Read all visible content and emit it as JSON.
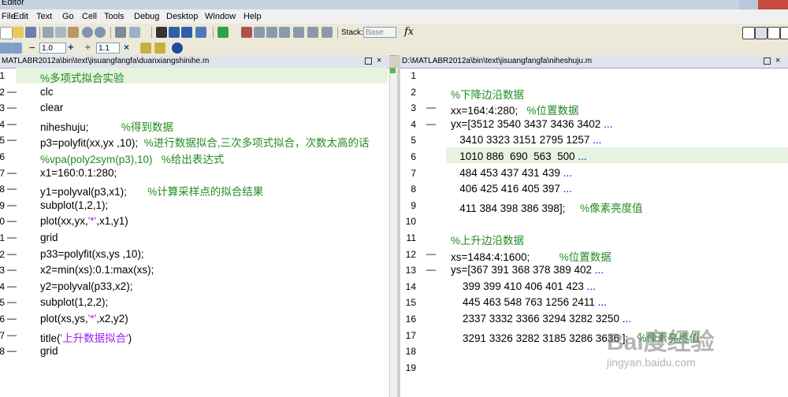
{
  "window": {
    "title": "Editor"
  },
  "menu": [
    "File",
    "Edit",
    "Text",
    "Go",
    "Cell",
    "Tools",
    "Debug",
    "Desktop",
    "Window",
    "Help"
  ],
  "toolbar": {
    "stack_label": "Stack:",
    "stack_value": "Base",
    "fx_label": "fx"
  },
  "cell_toolbar": {
    "minus": "−",
    "value1": "1.0",
    "plus": "+",
    "divide": "÷",
    "value2": "1.1",
    "times": "×"
  },
  "left_editor": {
    "path": "MATLABR2012a\\bin\\text\\jisuangfangfa\\duanxiangshinihe.m",
    "lines": [
      {
        "num": "1",
        "dash": "",
        "parts": [
          {
            "t": "%多项式拟合实验",
            "c": "cm"
          }
        ]
      },
      {
        "num": "2",
        "dash": "—",
        "parts": [
          {
            "t": "clc",
            "c": ""
          }
        ]
      },
      {
        "num": "3",
        "dash": "—",
        "parts": [
          {
            "t": "clear",
            "c": ""
          }
        ]
      },
      {
        "num": "4",
        "dash": "—",
        "parts": [
          {
            "t": "niheshuju;           ",
            "c": ""
          },
          {
            "t": "%得到数据",
            "c": "cm"
          }
        ]
      },
      {
        "num": "5",
        "dash": "—",
        "parts": [
          {
            "t": "p3=polyfit(xx,yx ,10);  ",
            "c": ""
          },
          {
            "t": "%进行数据拟合,三次多项式拟合，次数太高的话",
            "c": "cm"
          }
        ]
      },
      {
        "num": "6",
        "dash": "",
        "parts": [
          {
            "t": "%vpa(poly2sym(p3),10)   %给出表达式",
            "c": "cm"
          }
        ]
      },
      {
        "num": "7",
        "dash": "—",
        "parts": [
          {
            "t": "x1=160:0.1:280;",
            "c": ""
          }
        ]
      },
      {
        "num": "8",
        "dash": "—",
        "parts": [
          {
            "t": "y1=polyval(p3,x1);       ",
            "c": ""
          },
          {
            "t": "%计算采样点的拟合结果",
            "c": "cm"
          }
        ]
      },
      {
        "num": "9",
        "dash": "—",
        "parts": [
          {
            "t": "subplot(1,2,1);",
            "c": ""
          }
        ]
      },
      {
        "num": "10",
        "dash": "—",
        "parts": [
          {
            "t": "plot(xx,yx,",
            "c": ""
          },
          {
            "t": "'*'",
            "c": "str"
          },
          {
            "t": ",x1,y1)",
            "c": ""
          }
        ]
      },
      {
        "num": "11",
        "dash": "—",
        "parts": [
          {
            "t": "grid",
            "c": ""
          }
        ]
      },
      {
        "num": "12",
        "dash": "—",
        "parts": [
          {
            "t": "p33=polyfit(xs,ys ,10);",
            "c": ""
          }
        ]
      },
      {
        "num": "13",
        "dash": "—",
        "parts": [
          {
            "t": "x2=min(xs):0.1:max(xs);",
            "c": ""
          }
        ]
      },
      {
        "num": "14",
        "dash": "—",
        "parts": [
          {
            "t": "y2=polyval(p33,x2);",
            "c": ""
          }
        ]
      },
      {
        "num": "15",
        "dash": "—",
        "parts": [
          {
            "t": "subplot(1,2,2);",
            "c": ""
          }
        ]
      },
      {
        "num": "16",
        "dash": "—",
        "parts": [
          {
            "t": "plot(xs,ys,",
            "c": ""
          },
          {
            "t": "'*'",
            "c": "str"
          },
          {
            "t": ",x2,y2)",
            "c": ""
          }
        ]
      },
      {
        "num": "17",
        "dash": "—",
        "parts": [
          {
            "t": "title(",
            "c": ""
          },
          {
            "t": "'上升数据拟合'",
            "c": "str"
          },
          {
            "t": ")",
            "c": ""
          }
        ]
      },
      {
        "num": "18",
        "dash": "—",
        "parts": [
          {
            "t": "grid",
            "c": ""
          }
        ]
      }
    ]
  },
  "right_editor": {
    "path": "D:\\MATLABR2012a\\bin\\text\\jisuangfangfa\\niheshuju.m",
    "lines": [
      {
        "num": "1",
        "dash": "",
        "parts": []
      },
      {
        "num": "2",
        "dash": "",
        "parts": [
          {
            "t": "%下降边沿数据",
            "c": "cm"
          }
        ]
      },
      {
        "num": "3",
        "dash": "—",
        "parts": [
          {
            "t": "xx=164:4:280;   ",
            "c": ""
          },
          {
            "t": "%位置数据",
            "c": "cm"
          }
        ]
      },
      {
        "num": "4",
        "dash": "—",
        "parts": [
          {
            "t": "yx=[3512 3540 3437 3436 3402 ",
            "c": ""
          },
          {
            "t": "...",
            "c": "kw"
          }
        ]
      },
      {
        "num": "5",
        "dash": "",
        "parts": [
          {
            "t": "   3410 3323 3151 2795 1257 ",
            "c": ""
          },
          {
            "t": "...",
            "c": "kw"
          }
        ]
      },
      {
        "num": "6",
        "dash": "",
        "parts": [
          {
            "t": "   1010 886  690  563  500 ",
            "c": ""
          },
          {
            "t": "...",
            "c": "kw"
          }
        ]
      },
      {
        "num": "7",
        "dash": "",
        "parts": [
          {
            "t": "   484 453 437 431 439 ",
            "c": ""
          },
          {
            "t": "...",
            "c": "kw"
          }
        ]
      },
      {
        "num": "8",
        "dash": "",
        "parts": [
          {
            "t": "   406 425 416 405 397 ",
            "c": ""
          },
          {
            "t": "...",
            "c": "kw"
          }
        ]
      },
      {
        "num": "9",
        "dash": "",
        "parts": [
          {
            "t": "   411 384 398 386 398];     ",
            "c": ""
          },
          {
            "t": "%像素亮度值",
            "c": "cm"
          }
        ]
      },
      {
        "num": "10",
        "dash": "",
        "parts": []
      },
      {
        "num": "11",
        "dash": "",
        "parts": [
          {
            "t": "%上升边沿数据",
            "c": "cm"
          }
        ]
      },
      {
        "num": "12",
        "dash": "—",
        "parts": [
          {
            "t": "xs=1484:4:1600;          ",
            "c": ""
          },
          {
            "t": "%位置数据",
            "c": "cm"
          }
        ]
      },
      {
        "num": "13",
        "dash": "—",
        "parts": [
          {
            "t": "ys=[367 391 368 378 389 402 ",
            "c": ""
          },
          {
            "t": "...",
            "c": "kw"
          }
        ]
      },
      {
        "num": "14",
        "dash": "",
        "parts": [
          {
            "t": "    399 399 410 406 401 423 ",
            "c": ""
          },
          {
            "t": "...",
            "c": "kw"
          }
        ]
      },
      {
        "num": "15",
        "dash": "",
        "parts": [
          {
            "t": "    445 463 548 763 1256 2411 ",
            "c": ""
          },
          {
            "t": "...",
            "c": "kw"
          }
        ]
      },
      {
        "num": "16",
        "dash": "",
        "parts": [
          {
            "t": "    2337 3332 3366 3294 3282 3250 ",
            "c": ""
          },
          {
            "t": "...",
            "c": "kw"
          }
        ]
      },
      {
        "num": "17",
        "dash": "",
        "parts": [
          {
            "t": "    3291 3326 3282 3185 3286 3636 ];   ",
            "c": ""
          },
          {
            "t": "%像素亮度值",
            "c": "cm"
          }
        ]
      },
      {
        "num": "18",
        "dash": "",
        "parts": []
      },
      {
        "num": "19",
        "dash": "",
        "parts": []
      }
    ]
  },
  "watermark": {
    "logo": "Bai度经验",
    "url": "jingyan.baidu.com"
  },
  "colors": {
    "comment": "#228b22",
    "string": "#a020f0",
    "keyword": "#0000ff",
    "highlight": "#e6f3e0"
  }
}
